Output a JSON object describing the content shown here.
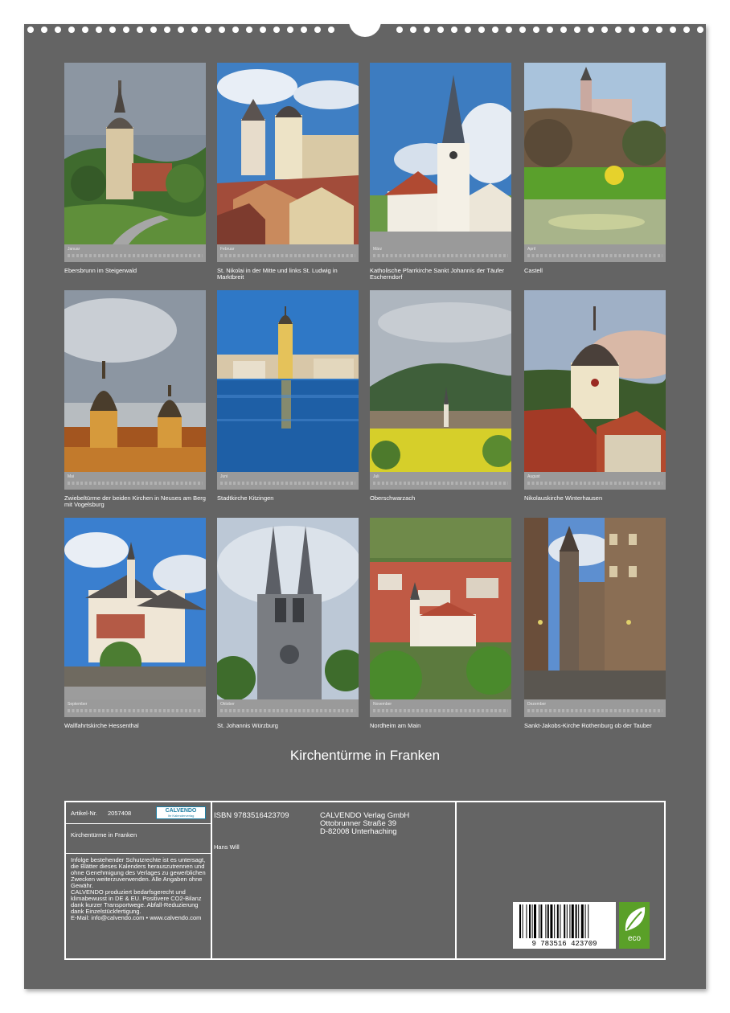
{
  "title": "Kirchentürme in Franken",
  "months": [
    {
      "month": "Januar",
      "caption": "Ebersbrunn im Steigerwald",
      "scene": "tower-green"
    },
    {
      "month": "Februar",
      "caption": "St. Nikolai in der Mitte und links St. Ludwig in Marktbreit",
      "scene": "town-roofs"
    },
    {
      "month": "März",
      "caption": "Katholische Pfarrkirche Sankt Johannis der Täufer Escherndorf",
      "scene": "white-church"
    },
    {
      "month": "April",
      "caption": "Castell",
      "scene": "pond-park"
    },
    {
      "month": "Mai",
      "caption": "Zwiebeltürme der beiden Kirchen in Neuses am Berg mit Vogelsburg",
      "scene": "onion-towers"
    },
    {
      "month": "Juni",
      "caption": "Stadtkirche Kitzingen",
      "scene": "river-town"
    },
    {
      "month": "Juli",
      "caption": "Oberschwarzach",
      "scene": "rapeseed-hills"
    },
    {
      "month": "August",
      "caption": "Nikolauskirche Winterhausen",
      "scene": "red-roof-tower"
    },
    {
      "month": "September",
      "caption": "Wallfahrtskirche Hessenthal",
      "scene": "pilgrim-church"
    },
    {
      "month": "Oktober",
      "caption": "St. Johannis Würzburg",
      "scene": "twin-spires"
    },
    {
      "month": "November",
      "caption": "Nordheim am Main",
      "scene": "vineyard-village"
    },
    {
      "month": "Dezember",
      "caption": "Sankt-Jakobs-Kirche Rothenburg ob der Tauber",
      "scene": "old-street"
    }
  ],
  "info": {
    "article_label": "Artikel-Nr.",
    "article_no": "2057408",
    "logo_name": "CALVENDO",
    "logo_sub": "Ihr Kalenderverlag",
    "product_title": "Kirchentürme in Franken",
    "legal": "Infolge bestehender Schutzrechte ist es untersagt, die Blätter dieses Kalenders herauszutrennen und ohne Genehmigung des Verlages zu gewerblichen Zwecken weiterzuverwenden. Alle Angaben ohne Gewähr.",
    "eco_text": "CALVENDO produziert bedarfsgerecht und klimabewusst in DE & EU. Positivere CO2-Bilanz dank kurzer Transportwege. Abfall-Reduzierung dank Einzelstückfertigung.",
    "email": "E-Mail: info@calvendo.com • www.calvendo.com",
    "isbn": "ISBN 9783516423709",
    "author": "Hans Will",
    "publisher": "CALVENDO Verlag GmbH",
    "street": "Ottobrunner Straße 39",
    "city": "D-82008 Unterhaching",
    "barcode_digits": "9 783516 423709",
    "eco_label": "eco"
  },
  "colors": {
    "page": "#646464",
    "strip": "#9a9a9a",
    "eco": "#5aa028",
    "logo": "#1f7fa3"
  }
}
